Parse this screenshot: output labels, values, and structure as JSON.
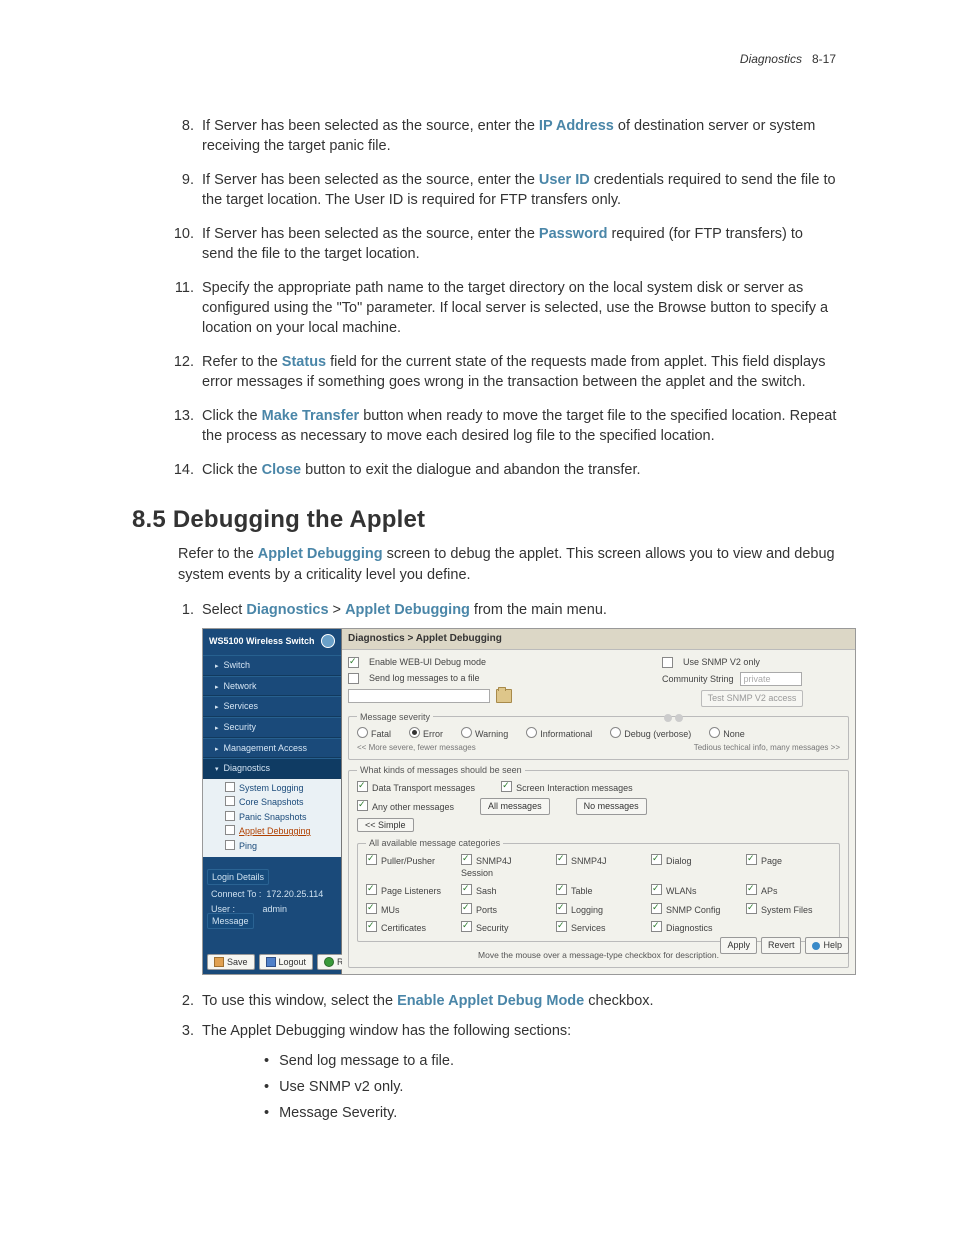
{
  "header": {
    "section": "Diagnostics",
    "page_label": "8-17"
  },
  "steps": [
    {
      "n": 8,
      "pre": "If Server has been selected as the source, enter the ",
      "term": "IP Address",
      "post": " of destination server or system receiving the target panic file."
    },
    {
      "n": 9,
      "pre": "If Server has been selected as the source, enter the ",
      "term": "User ID",
      "post": " credentials required to send the file to the target location. The User ID is required for FTP transfers only."
    },
    {
      "n": 10,
      "pre": "If Server has been selected as the source, enter the ",
      "term": "Password",
      "post": " required (for FTP transfers) to send the file to the target location."
    },
    {
      "n": 11,
      "pre": "Specify the appropriate path name to the target directory on the local system disk or server as configured using the \"To\" parameter. If local server is selected, use the Browse button to specify a location on your local machine.",
      "term": "",
      "post": ""
    },
    {
      "n": 12,
      "pre": "Refer to the ",
      "term": "Status",
      "post": " field for the current state of the requests made from applet. This field displays error messages if something goes wrong in the transaction between the applet and the switch."
    },
    {
      "n": 13,
      "pre": "Click the ",
      "term": "Make Transfer",
      "post": " button when ready to move the target file to the specified location. Repeat the process as necessary to move each desired log file to the specified location."
    },
    {
      "n": 14,
      "pre": "Click the ",
      "term": "Close",
      "post": " button to exit the dialogue and abandon the transfer."
    }
  ],
  "section85": {
    "heading": "8.5 Debugging the Applet",
    "intro_pre": "Refer to the ",
    "intro_term": "Applet Debugging",
    "intro_post": " screen to debug the applet. This screen allows you to view and debug system events by a criticality level you define.",
    "step1_pre": "Select ",
    "step1_t1": "Diagnostics",
    "step1_mid": "  >  ",
    "step1_t2": "Applet Debugging",
    "step1_post": " from the main menu.",
    "step2_pre": "To use this window, select the ",
    "step2_term": "Enable Applet Debug Mode",
    "step2_post": " checkbox.",
    "step3": "The Applet Debugging window has the following sections:",
    "bullets": [
      "Send log message to a file.",
      "Use SNMP v2 only.",
      "Message Severity."
    ]
  },
  "ui": {
    "product": "WS5100 Wireless Switch",
    "nav": [
      "Switch",
      "Network",
      "Services",
      "Security",
      "Management Access",
      "Diagnostics"
    ],
    "subnav": [
      "System Logging",
      "Core Snapshots",
      "Panic Snapshots",
      "Applet Debugging",
      "Ping"
    ],
    "login": {
      "title": "Login Details",
      "connect_lbl": "Connect To :",
      "connect_val": "172.20.25.114",
      "user_lbl": "User :",
      "user_val": "admin"
    },
    "message_title": "Message",
    "sb_buttons": {
      "save": "Save",
      "logout": "Logout",
      "refresh": "Refresh"
    },
    "crumb": "Diagnostics > Applet Debugging",
    "enable_debug": "Enable WEB-UI Debug mode",
    "send_log": "Send log messages to a file",
    "snmp_only": "Use SNMP V2 only",
    "comm_lbl": "Community String",
    "comm_val": "private",
    "test_btn": "Test SNMP V2 access",
    "sev_legend": "Message severity",
    "sev": [
      "Fatal",
      "Error",
      "Warning",
      "Informational",
      "Debug (verbose)",
      "None"
    ],
    "sev_note_l": "<< More severe, fewer messages",
    "sev_note_r": "Tedious techical info, many messages >>",
    "kinds_legend": "What kinds of messages should be seen",
    "kinds_top": [
      "Data Transport messages",
      "Screen Interaction messages"
    ],
    "kinds_any": "Any other messages",
    "kinds_btns": {
      "all": "All messages",
      "none": "No messages",
      "simple": "<< Simple"
    },
    "cats_legend": "All available message categories",
    "cats": [
      "Puller/Pusher",
      "SNMP4J Session",
      "SNMP4J",
      "Dialog",
      "Page",
      "Page Listeners",
      "Sash",
      "Table",
      "WLANs",
      "APs",
      "MUs",
      "Ports",
      "Logging",
      "SNMP Config",
      "System Files",
      "Certificates",
      "Security",
      "Services",
      "Diagnostics"
    ],
    "helptext": "Move the mouse over a message-type checkbox for description.",
    "bottom": {
      "apply": "Apply",
      "revert": "Revert",
      "help": "Help"
    }
  }
}
